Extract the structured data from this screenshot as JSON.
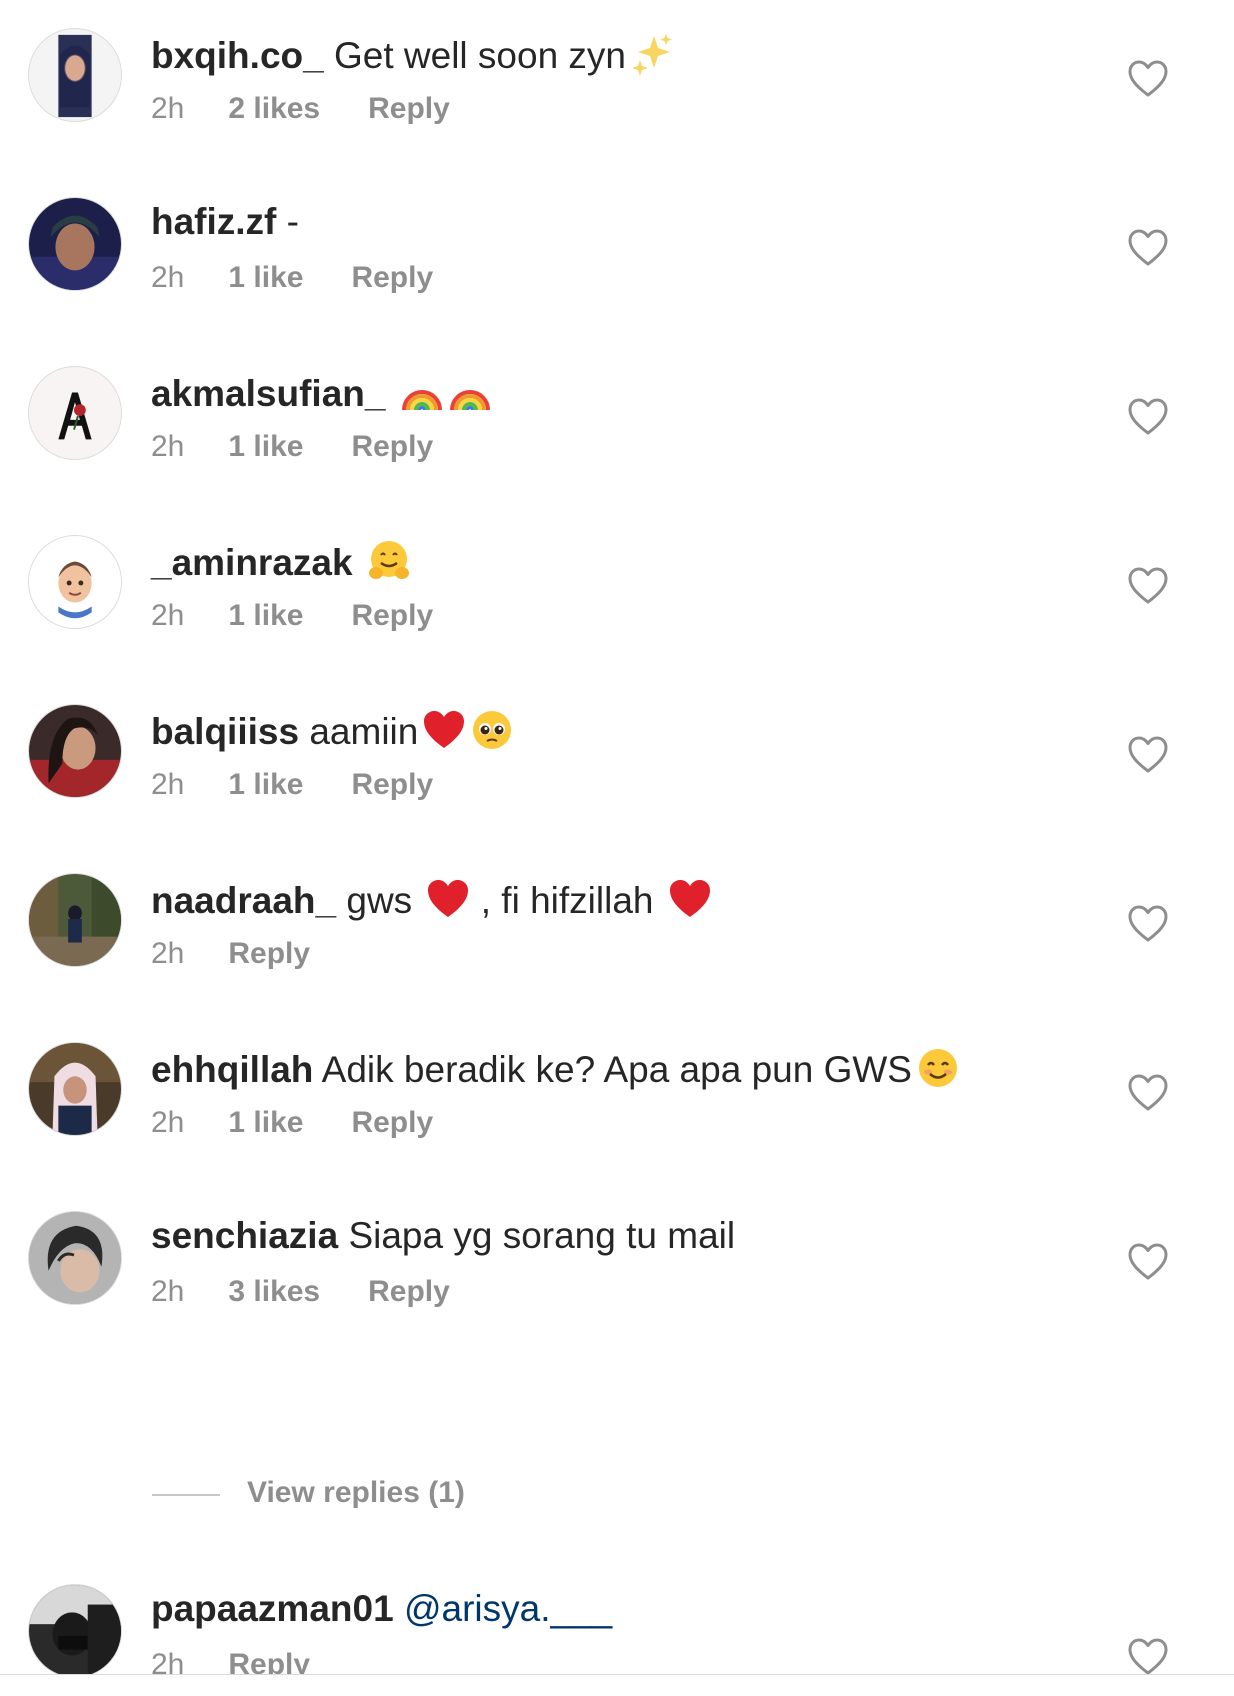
{
  "comments": [
    {
      "username": "bxqih.co_",
      "text": "Get well soon zyn",
      "emojis": [
        "sparkles"
      ],
      "time": "2h",
      "likes": "2 likes",
      "reply": "Reply"
    },
    {
      "username": "hafiz.zf",
      "text": "-",
      "emojis": [],
      "time": "2h",
      "likes": "1 like",
      "reply": "Reply"
    },
    {
      "username": "akmalsufian_",
      "text": "",
      "emojis": [
        "rainbow",
        "rainbow"
      ],
      "time": "2h",
      "likes": "1 like",
      "reply": "Reply"
    },
    {
      "username": "_aminrazak",
      "text": "",
      "emojis": [
        "hugging-face"
      ],
      "time": "2h",
      "likes": "1 like",
      "reply": "Reply"
    },
    {
      "username": "balqiiiss",
      "text": "aamiin",
      "emojis": [
        "red-heart",
        "pleading-face"
      ],
      "time": "2h",
      "likes": "1 like",
      "reply": "Reply"
    },
    {
      "username": "naadraah_",
      "text_a": "gws",
      "text_b": ", fi hifzillah",
      "emojis": [
        "red-heart",
        "red-heart"
      ],
      "time": "2h",
      "likes": "",
      "reply": "Reply"
    },
    {
      "username": "ehhqillah",
      "text": "Adik beradik ke? Apa apa pun GWS",
      "emojis": [
        "smiling-face"
      ],
      "time": "2h",
      "likes": "1 like",
      "reply": "Reply"
    },
    {
      "username": "senchiazia",
      "text": "Siapa yg sorang tu mail",
      "emojis": [],
      "time": "2h",
      "likes": "3 likes",
      "reply": "Reply"
    },
    {
      "username": "papaazman01",
      "text": "@arisya.___",
      "emojis": [],
      "time": "2h",
      "likes": "",
      "reply": "Reply"
    }
  ],
  "view_replies": "View replies (1)",
  "colors": {
    "text": "#262626",
    "secondary": "#8e8e8e",
    "mention": "#00376b",
    "heart_red": "#e0202a"
  }
}
